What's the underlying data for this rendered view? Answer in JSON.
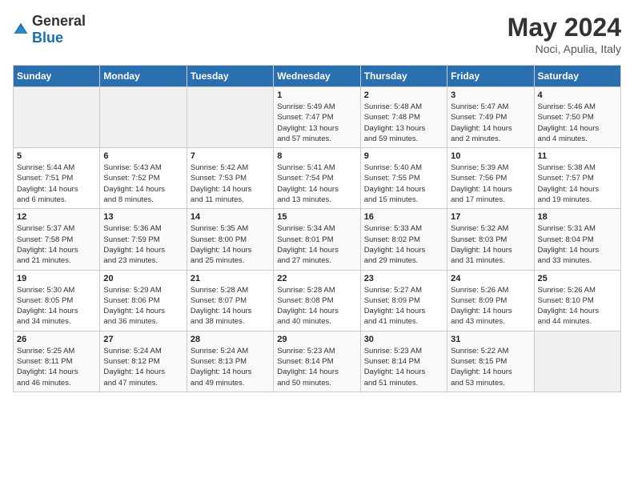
{
  "header": {
    "logo_general": "General",
    "logo_blue": "Blue",
    "title": "May 2024",
    "location": "Noci, Apulia, Italy"
  },
  "days_of_week": [
    "Sunday",
    "Monday",
    "Tuesday",
    "Wednesday",
    "Thursday",
    "Friday",
    "Saturday"
  ],
  "weeks": [
    [
      {
        "day": "",
        "info": ""
      },
      {
        "day": "",
        "info": ""
      },
      {
        "day": "",
        "info": ""
      },
      {
        "day": "1",
        "info": "Sunrise: 5:49 AM\nSunset: 7:47 PM\nDaylight: 13 hours\nand 57 minutes."
      },
      {
        "day": "2",
        "info": "Sunrise: 5:48 AM\nSunset: 7:48 PM\nDaylight: 13 hours\nand 59 minutes."
      },
      {
        "day": "3",
        "info": "Sunrise: 5:47 AM\nSunset: 7:49 PM\nDaylight: 14 hours\nand 2 minutes."
      },
      {
        "day": "4",
        "info": "Sunrise: 5:46 AM\nSunset: 7:50 PM\nDaylight: 14 hours\nand 4 minutes."
      }
    ],
    [
      {
        "day": "5",
        "info": "Sunrise: 5:44 AM\nSunset: 7:51 PM\nDaylight: 14 hours\nand 6 minutes."
      },
      {
        "day": "6",
        "info": "Sunrise: 5:43 AM\nSunset: 7:52 PM\nDaylight: 14 hours\nand 8 minutes."
      },
      {
        "day": "7",
        "info": "Sunrise: 5:42 AM\nSunset: 7:53 PM\nDaylight: 14 hours\nand 11 minutes."
      },
      {
        "day": "8",
        "info": "Sunrise: 5:41 AM\nSunset: 7:54 PM\nDaylight: 14 hours\nand 13 minutes."
      },
      {
        "day": "9",
        "info": "Sunrise: 5:40 AM\nSunset: 7:55 PM\nDaylight: 14 hours\nand 15 minutes."
      },
      {
        "day": "10",
        "info": "Sunrise: 5:39 AM\nSunset: 7:56 PM\nDaylight: 14 hours\nand 17 minutes."
      },
      {
        "day": "11",
        "info": "Sunrise: 5:38 AM\nSunset: 7:57 PM\nDaylight: 14 hours\nand 19 minutes."
      }
    ],
    [
      {
        "day": "12",
        "info": "Sunrise: 5:37 AM\nSunset: 7:58 PM\nDaylight: 14 hours\nand 21 minutes."
      },
      {
        "day": "13",
        "info": "Sunrise: 5:36 AM\nSunset: 7:59 PM\nDaylight: 14 hours\nand 23 minutes."
      },
      {
        "day": "14",
        "info": "Sunrise: 5:35 AM\nSunset: 8:00 PM\nDaylight: 14 hours\nand 25 minutes."
      },
      {
        "day": "15",
        "info": "Sunrise: 5:34 AM\nSunset: 8:01 PM\nDaylight: 14 hours\nand 27 minutes."
      },
      {
        "day": "16",
        "info": "Sunrise: 5:33 AM\nSunset: 8:02 PM\nDaylight: 14 hours\nand 29 minutes."
      },
      {
        "day": "17",
        "info": "Sunrise: 5:32 AM\nSunset: 8:03 PM\nDaylight: 14 hours\nand 31 minutes."
      },
      {
        "day": "18",
        "info": "Sunrise: 5:31 AM\nSunset: 8:04 PM\nDaylight: 14 hours\nand 33 minutes."
      }
    ],
    [
      {
        "day": "19",
        "info": "Sunrise: 5:30 AM\nSunset: 8:05 PM\nDaylight: 14 hours\nand 34 minutes."
      },
      {
        "day": "20",
        "info": "Sunrise: 5:29 AM\nSunset: 8:06 PM\nDaylight: 14 hours\nand 36 minutes."
      },
      {
        "day": "21",
        "info": "Sunrise: 5:28 AM\nSunset: 8:07 PM\nDaylight: 14 hours\nand 38 minutes."
      },
      {
        "day": "22",
        "info": "Sunrise: 5:28 AM\nSunset: 8:08 PM\nDaylight: 14 hours\nand 40 minutes."
      },
      {
        "day": "23",
        "info": "Sunrise: 5:27 AM\nSunset: 8:09 PM\nDaylight: 14 hours\nand 41 minutes."
      },
      {
        "day": "24",
        "info": "Sunrise: 5:26 AM\nSunset: 8:09 PM\nDaylight: 14 hours\nand 43 minutes."
      },
      {
        "day": "25",
        "info": "Sunrise: 5:26 AM\nSunset: 8:10 PM\nDaylight: 14 hours\nand 44 minutes."
      }
    ],
    [
      {
        "day": "26",
        "info": "Sunrise: 5:25 AM\nSunset: 8:11 PM\nDaylight: 14 hours\nand 46 minutes."
      },
      {
        "day": "27",
        "info": "Sunrise: 5:24 AM\nSunset: 8:12 PM\nDaylight: 14 hours\nand 47 minutes."
      },
      {
        "day": "28",
        "info": "Sunrise: 5:24 AM\nSunset: 8:13 PM\nDaylight: 14 hours\nand 49 minutes."
      },
      {
        "day": "29",
        "info": "Sunrise: 5:23 AM\nSunset: 8:14 PM\nDaylight: 14 hours\nand 50 minutes."
      },
      {
        "day": "30",
        "info": "Sunrise: 5:23 AM\nSunset: 8:14 PM\nDaylight: 14 hours\nand 51 minutes."
      },
      {
        "day": "31",
        "info": "Sunrise: 5:22 AM\nSunset: 8:15 PM\nDaylight: 14 hours\nand 53 minutes."
      },
      {
        "day": "",
        "info": ""
      }
    ]
  ]
}
